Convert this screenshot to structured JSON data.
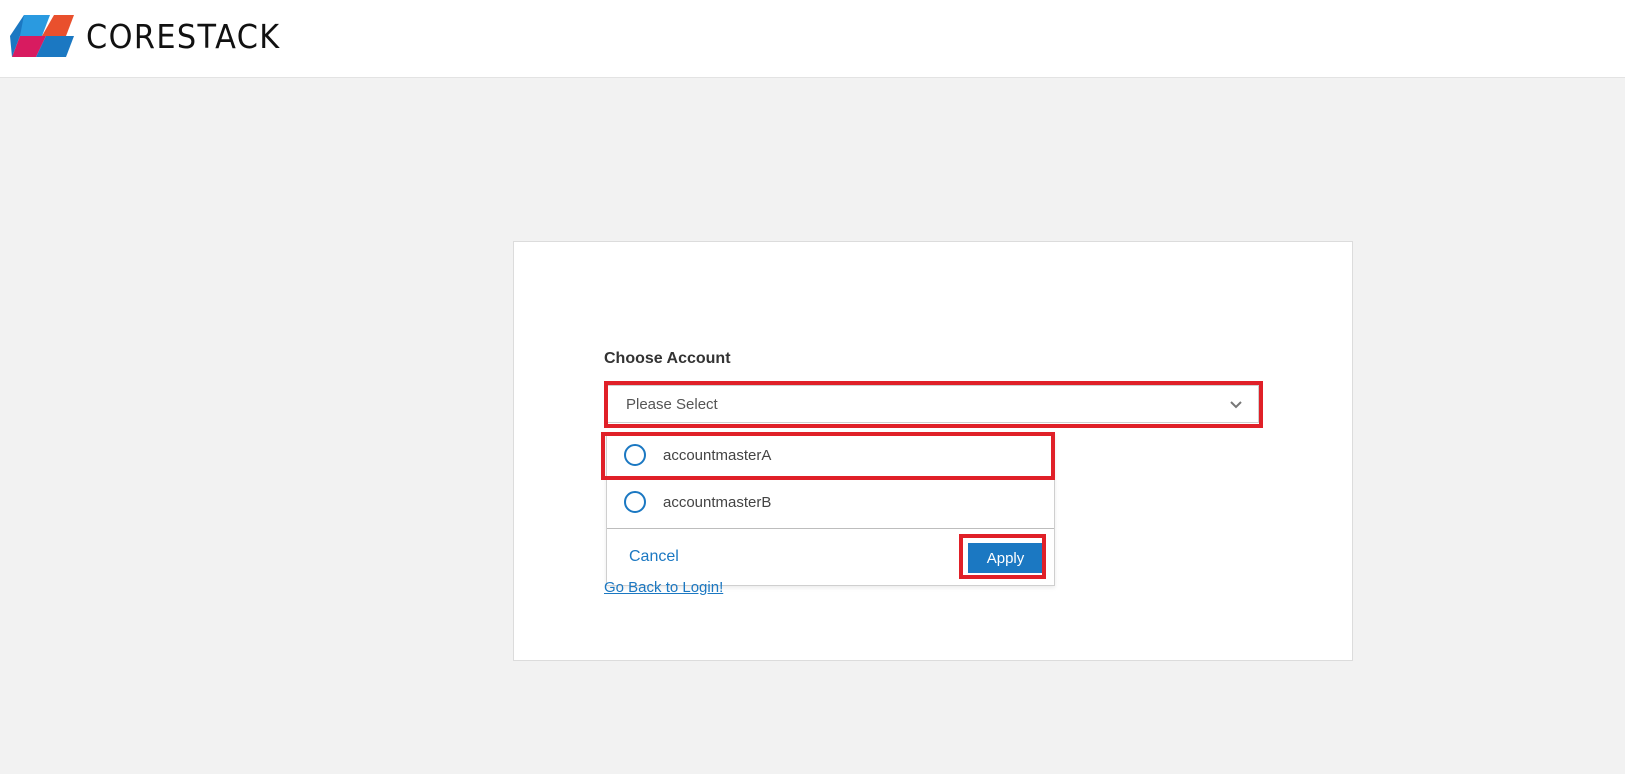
{
  "header": {
    "brand": "CORESTACK",
    "logo_icon": "corestack-logo-icon",
    "logo_colors": [
      "#1b78c2",
      "#e9502d",
      "#d81b60",
      "#2a9ae0"
    ]
  },
  "form": {
    "label": "Choose Account",
    "select": {
      "value": "Please Select",
      "chevron_icon": "chevron-down-icon"
    },
    "options": [
      {
        "label": "accountmasterA",
        "selected": false
      },
      {
        "label": "accountmasterB",
        "selected": false
      }
    ],
    "cancel_label": "Cancel",
    "apply_label": "Apply",
    "back_link": "Go Back to Login!"
  },
  "colors": {
    "accent": "#1b78c2",
    "highlight": "#e02028",
    "background": "#f2f2f2"
  }
}
